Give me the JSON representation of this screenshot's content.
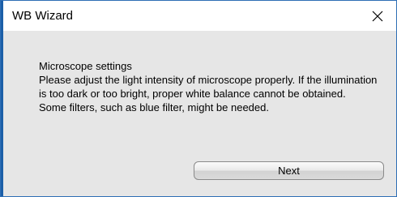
{
  "window": {
    "title": "WB Wizard",
    "close_icon": "close-icon",
    "close_glyph": "×"
  },
  "message": {
    "heading": "Microscope settings",
    "line1": "Please adjust the light intensity of microscope properly. If the illumination is too dark or too bright, proper white balance cannot be obtained.",
    "line2": "Some filters, such as blue filter, might be needed."
  },
  "buttons": {
    "next_label": "Next"
  },
  "colors": {
    "accent": "#1c5fa8",
    "titlebar": "#ffffff",
    "content_bg": "#e6e6e6"
  }
}
